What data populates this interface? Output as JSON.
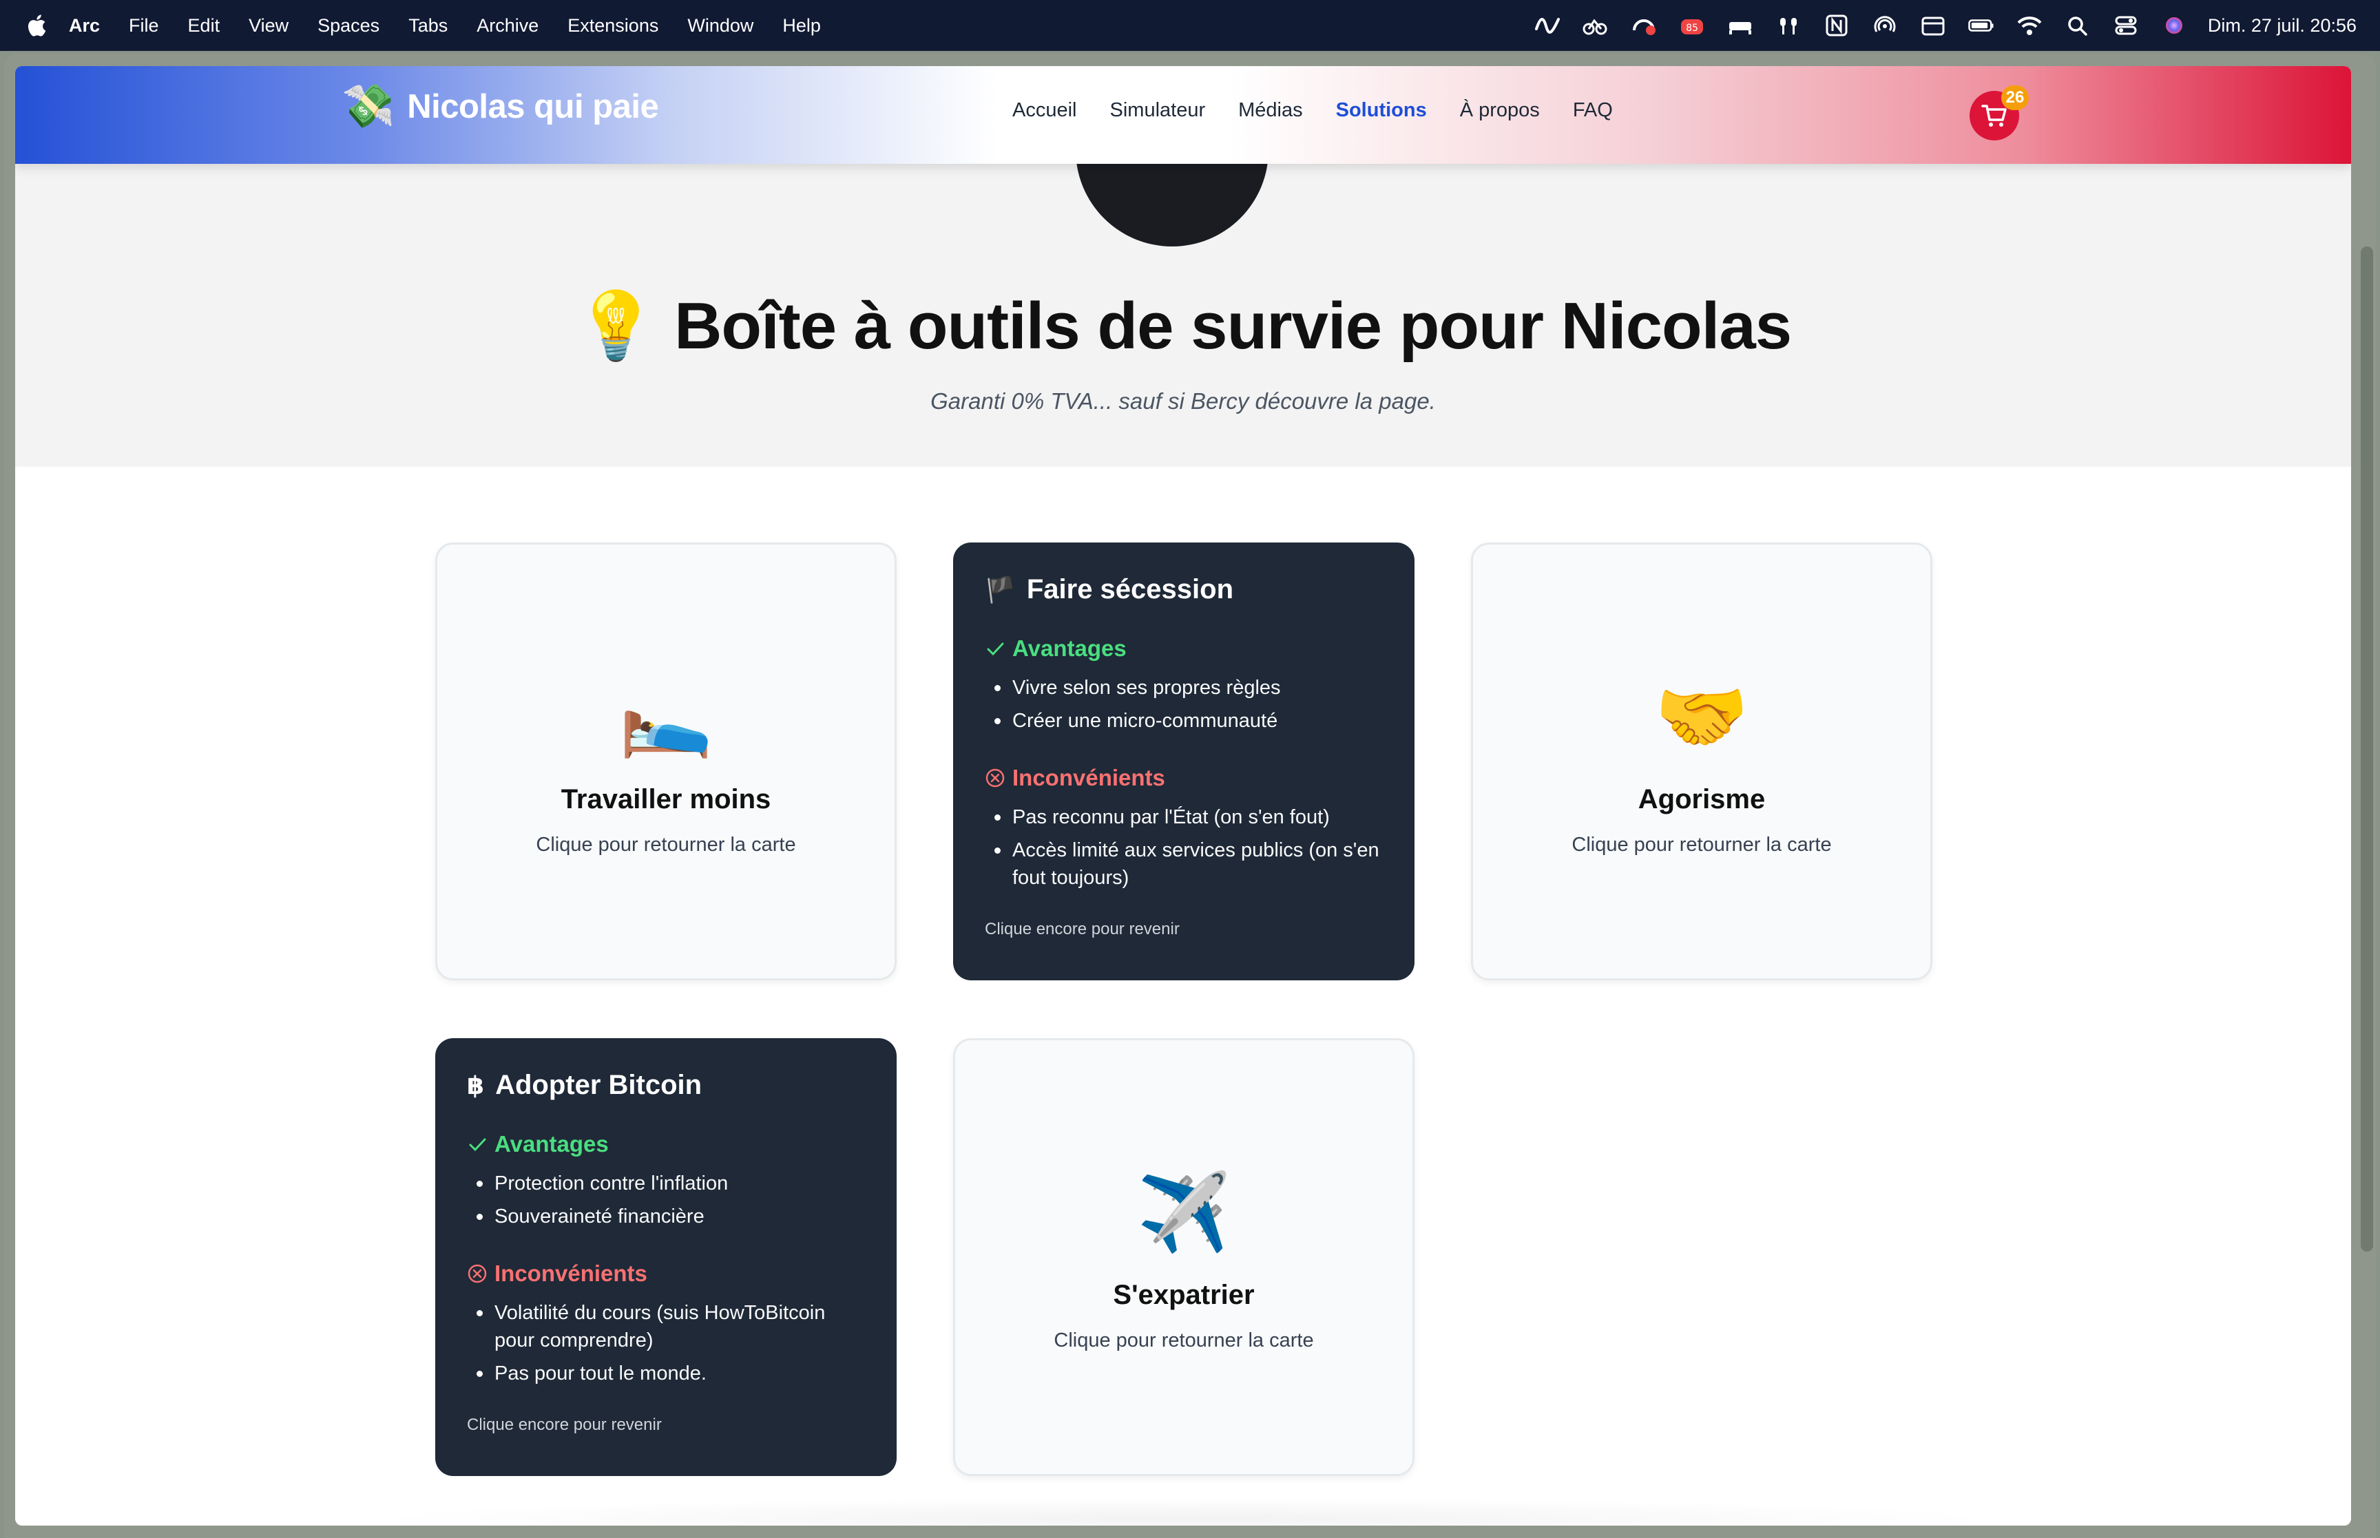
{
  "menubar": {
    "items": [
      "Arc",
      "File",
      "Edit",
      "View",
      "Spaces",
      "Tabs",
      "Archive",
      "Extensions",
      "Window",
      "Help"
    ],
    "status_badge": "85",
    "clock": "Dim. 27 juil.  20:56"
  },
  "site": {
    "logo_text": "Nicolas qui paie",
    "logo_icon": "💸",
    "nav": [
      "Accueil",
      "Simulateur",
      "Médias",
      "Solutions",
      "À propos",
      "FAQ"
    ],
    "active_nav": "Solutions",
    "cart_count": "26",
    "colors": {
      "brand_blue": "#2451d6",
      "brand_red": "#dc1438",
      "card_dark": "#1f2937",
      "pro_green": "#4ade80",
      "con_red": "#f87171",
      "active_link": "#1d4ed8"
    }
  },
  "hero": {
    "title": "💡 Boîte à outils de survie pour Nicolas",
    "subtitle": "Garanti 0% TVA... sauf si Bercy découvre la page."
  },
  "cards": {
    "travailler": {
      "emoji": "🛌",
      "title": "Travailler moins",
      "hint": "Clique pour retourner la carte"
    },
    "secession": {
      "icon": "🏴",
      "title": "Faire sécession",
      "pros_label": "Avantages",
      "pros": [
        "Vivre selon ses propres règles",
        "Créer une micro-communauté"
      ],
      "cons_label": "Inconvénients",
      "cons": [
        "Pas reconnu par l'État (on s'en fout)",
        "Accès limité aux services publics (on s'en fout toujours)"
      ],
      "hint": "Clique encore pour revenir"
    },
    "agorisme": {
      "emoji": "🤝",
      "title": "Agorisme",
      "hint": "Clique pour retourner la carte"
    },
    "bitcoin": {
      "icon": "฿",
      "title": "Adopter Bitcoin",
      "pros_label": "Avantages",
      "pros": [
        "Protection contre l'inflation",
        "Souveraineté financière"
      ],
      "cons_label": "Inconvénients",
      "cons": [
        "Volatilité du cours (suis HowToBitcoin pour comprendre)",
        "Pas pour tout le monde."
      ],
      "hint": "Clique encore pour revenir"
    },
    "expatrier": {
      "emoji": "✈️",
      "title": "S'expatrier",
      "hint": "Clique pour retourner la carte"
    }
  }
}
